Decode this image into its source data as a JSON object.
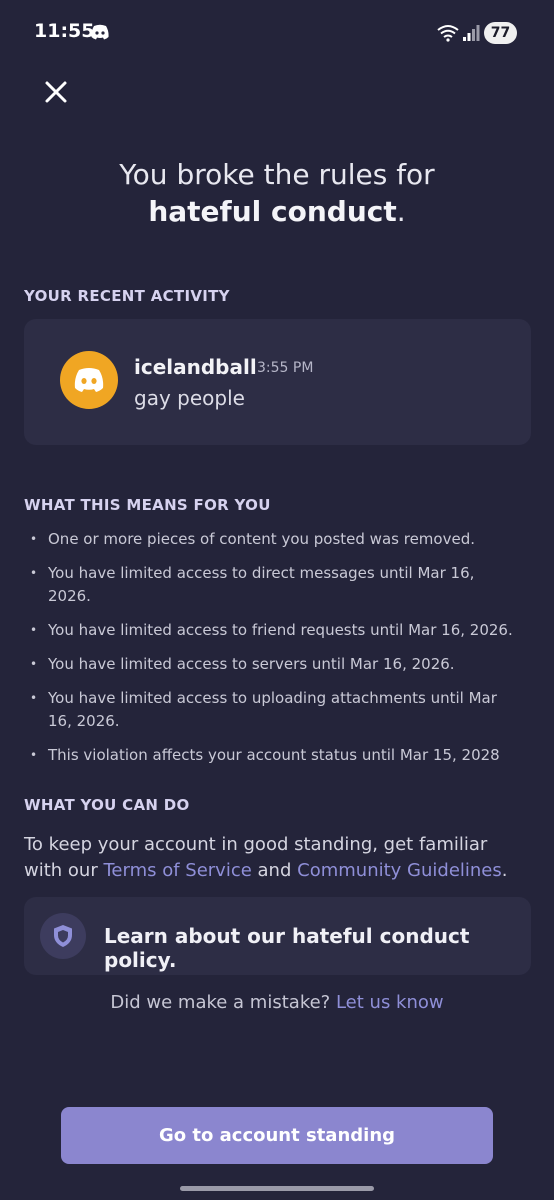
{
  "status_bar": {
    "time": "11:55",
    "battery": "77"
  },
  "headline": {
    "line1": "You broke the rules for",
    "line2_bold": "hateful conduct",
    "line2_end": "."
  },
  "recent_activity": {
    "title": "YOUR RECENT ACTIVITY",
    "username": "icelandball",
    "time": "3:55 PM",
    "message": "gay people",
    "avatar_color": "#f0a623"
  },
  "means": {
    "title": "WHAT THIS MEANS FOR YOU",
    "items": [
      "One or more pieces of content you posted was removed.",
      "You have limited access to direct messages until Mar 16, 2026.",
      "You have limited access to friend requests until Mar 16, 2026.",
      "You have limited access to servers until Mar 16, 2026.",
      "You have limited access to uploading attachments until Mar 16, 2026.",
      "This violation affects your account status until Mar 15, 2028"
    ]
  },
  "can_do": {
    "title": "WHAT YOU CAN DO",
    "text_before": "To keep your account in good standing, get familiar with our",
    "tos_link": "Terms of Service",
    "and": "and",
    "guidelines_link": "Community Guidelines",
    "period": "."
  },
  "policy": {
    "label": "Learn about our hateful conduct policy."
  },
  "mistake": {
    "text": "Did we make a mistake?",
    "link": "Let us know"
  },
  "primary_button": {
    "label": "Go to account standing",
    "color": "#8b86cf"
  }
}
